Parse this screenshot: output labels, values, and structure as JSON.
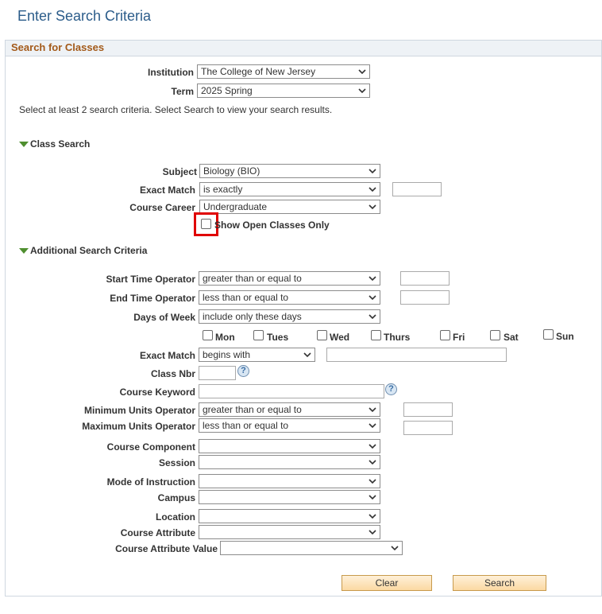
{
  "page_title": "Enter Search Criteria",
  "panel_title": "Search for Classes",
  "institution": {
    "label": "Institution",
    "value": "The College of New Jersey"
  },
  "term": {
    "label": "Term",
    "value": "2025 Spring"
  },
  "instructions": "Select at least 2 search criteria. Select Search to view your search results.",
  "class_search": {
    "section_label": "Class Search",
    "subject": {
      "label": "Subject",
      "value": "Biology (BIO)"
    },
    "exact_match": {
      "label": "Exact Match",
      "value": "is exactly",
      "input": ""
    },
    "course_career": {
      "label": "Course Career",
      "value": "Undergraduate"
    },
    "open_only": {
      "label": "Show Open Classes Only",
      "checked": false
    }
  },
  "additional": {
    "section_label": "Additional Search Criteria",
    "start_time": {
      "label": "Start Time Operator",
      "value": "greater than or equal to",
      "input": ""
    },
    "end_time": {
      "label": "End Time Operator",
      "value": "less than or equal to",
      "input": ""
    },
    "days_of_week": {
      "label": "Days of Week",
      "value": "include only these days"
    },
    "days": [
      "Mon",
      "Tues",
      "Wed",
      "Thurs",
      "Fri",
      "Sat",
      "Sun"
    ],
    "exact_match": {
      "label": "Exact Match",
      "value": "begins with",
      "input": ""
    },
    "class_nbr": {
      "label": "Class Nbr",
      "input": ""
    },
    "course_keyword": {
      "label": "Course Keyword",
      "input": ""
    },
    "min_units": {
      "label": "Minimum Units Operator",
      "value": "greater than or equal to",
      "input": ""
    },
    "max_units": {
      "label": "Maximum Units Operator",
      "value": "less than or equal to",
      "input": ""
    },
    "course_component": {
      "label": "Course Component",
      "value": ""
    },
    "session": {
      "label": "Session",
      "value": ""
    },
    "mode_of_instruction": {
      "label": "Mode of Instruction",
      "value": ""
    },
    "campus": {
      "label": "Campus",
      "value": ""
    },
    "location": {
      "label": "Location",
      "value": ""
    },
    "course_attribute": {
      "label": "Course Attribute",
      "value": ""
    },
    "course_attribute_value": {
      "label": "Course Attribute Value",
      "value": ""
    }
  },
  "help_icon": "?",
  "buttons": {
    "clear": "Clear",
    "search": "Search"
  },
  "colors": {
    "title": "#2b5c8a",
    "panel_title": "#a35a1a",
    "highlight": "#e00000",
    "toggle": "#4f8f2f"
  }
}
